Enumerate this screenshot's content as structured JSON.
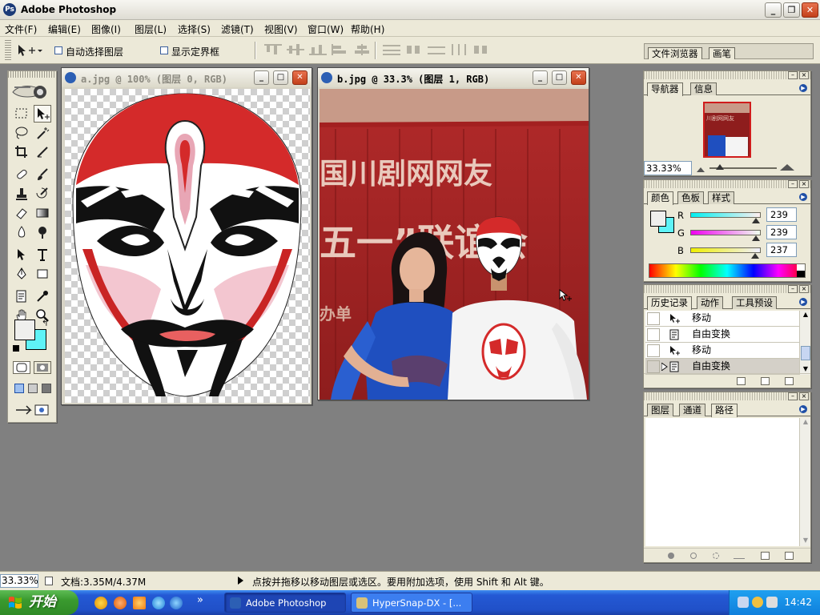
{
  "app": {
    "title": "Adobe Photoshop",
    "window_buttons": {
      "minimize": "_",
      "restore": "❐",
      "close": "✕"
    }
  },
  "menu": [
    "文件(F)",
    "编辑(E)",
    "图像(I)",
    "图层(L)",
    "选择(S)",
    "滤镜(T)",
    "视图(V)",
    "窗口(W)",
    "帮助(H)"
  ],
  "options_bar": {
    "auto_select_layer": "自动选择图层",
    "show_bounding_box": "显示定界框",
    "palette_well_tabs": [
      "文件浏览器",
      "画笔"
    ]
  },
  "documents": [
    {
      "title": "a.jpg @ 100% (图层 0, RGB)",
      "active": false
    },
    {
      "title": "b.jpg @ 33.3% (图层 1, RGB)",
      "active": true,
      "photo_text": {
        "line1": "国川剧网网友",
        "line2": "五一”联谊会",
        "bottom": "办单"
      }
    }
  ],
  "navigator": {
    "tabs": [
      "导航器",
      "信息"
    ],
    "zoom": "33.33%",
    "thumb_text": "川剧网网友"
  },
  "color": {
    "tabs": [
      "颜色",
      "色板",
      "样式"
    ],
    "channels": [
      {
        "label": "R",
        "value": "239"
      },
      {
        "label": "G",
        "value": "239"
      },
      {
        "label": "B",
        "value": "237"
      }
    ],
    "foreground": "#efefed",
    "background": "#5ff3f7"
  },
  "history": {
    "tabs": [
      "历史记录",
      "动作",
      "工具预设"
    ],
    "items": [
      {
        "label": "移动",
        "icon": "move-icon"
      },
      {
        "label": "自由变换",
        "icon": "transform-icon"
      },
      {
        "label": "移动",
        "icon": "move-icon"
      },
      {
        "label": "自由变换",
        "icon": "transform-icon"
      }
    ]
  },
  "layers": {
    "tabs": [
      "图层",
      "通道",
      "路径"
    ]
  },
  "statusbar": {
    "zoom": "33.33%",
    "doc": "文档:3.35M/4.37M",
    "hint": "点按并拖移以移动图层或选区。要用附加选项，使用 Shift 和 Alt 键。"
  },
  "taskbar": {
    "start": "开始",
    "tasks": [
      {
        "label": "Adobe Photoshop",
        "active": true
      },
      {
        "label": "HyperSnap-DX - [...",
        "active": false
      }
    ],
    "overflow": "»",
    "clock": "14:42"
  }
}
